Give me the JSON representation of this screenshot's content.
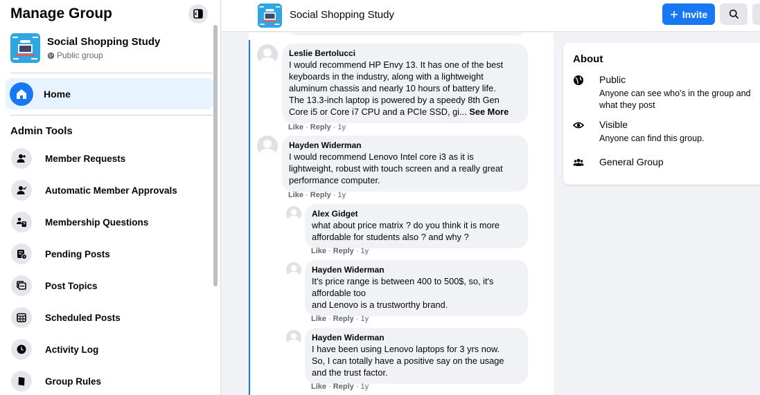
{
  "sidebar": {
    "title": "Manage Group",
    "group": {
      "name": "Social Shopping Study",
      "privacy": "Public group"
    },
    "home_label": "Home",
    "admin_tools_title": "Admin Tools",
    "items": [
      {
        "label": "Member Requests",
        "icon": "member-requests-icon"
      },
      {
        "label": "Automatic Member Approvals",
        "icon": "auto-approvals-icon"
      },
      {
        "label": "Membership Questions",
        "icon": "membership-questions-icon"
      },
      {
        "label": "Pending Posts",
        "icon": "pending-posts-icon"
      },
      {
        "label": "Post Topics",
        "icon": "post-topics-icon"
      },
      {
        "label": "Scheduled Posts",
        "icon": "scheduled-posts-icon"
      },
      {
        "label": "Activity Log",
        "icon": "clock-icon"
      },
      {
        "label": "Group Rules",
        "icon": "book-icon"
      }
    ]
  },
  "topbar": {
    "group_name": "Social Shopping Study",
    "invite_label": "Invite"
  },
  "comments": [
    {
      "author": "Leslie Bertolucci",
      "lines": [
        "I would recommend HP Envy 13. It has one of the best",
        "keyboards in the industry, along with a lightweight",
        "aluminum chassis and nearly 10 hours of battery life.",
        "The 13.3-inch laptop is powered by a speedy 8th Gen",
        "Core i5 or Core i7 CPU and a PCIe SSD, gi..."
      ],
      "see_more": "See More",
      "like": "Like",
      "reply": "Reply",
      "time": "1y"
    },
    {
      "author": "Hayden Widerman",
      "lines": [
        "I would recommend Lenovo Intel core i3 as it is",
        "lightweight, robust with touch screen and a really great",
        "performance computer."
      ],
      "like": "Like",
      "reply": "Reply",
      "time": "1y"
    },
    {
      "author": "Alex Gidget",
      "lines": [
        "what about price matrix ? do you think it is more",
        "affordable for students also ? and why ?"
      ],
      "like": "Like",
      "reply": "Reply",
      "time": "1y"
    },
    {
      "author": "Hayden Widerman",
      "lines": [
        "It's price range is between 400 to 500$, so, it's",
        "affordable too",
        "and Lenovo is a trustworthy brand."
      ],
      "like": "Like",
      "reply": "Reply",
      "time": "1y"
    },
    {
      "author": "Hayden Widerman",
      "lines": [
        "I have been using Lenovo laptops for 3 yrs now.",
        "So, I can totally have a positive say on the usage",
        "and the trust factor."
      ],
      "like": "Like",
      "reply": "Reply",
      "time": "1y"
    }
  ],
  "about": {
    "title": "About",
    "public_title": "Public",
    "public_desc": "Anyone can see who's in the group and what they post",
    "visible_title": "Visible",
    "visible_desc": "Anyone can find this group.",
    "general_title": "General Group"
  },
  "colors": {
    "accent": "#1877f2",
    "bubble": "#f0f2f5",
    "muted_text": "#65676b",
    "thumb": "#2fa6e4"
  }
}
